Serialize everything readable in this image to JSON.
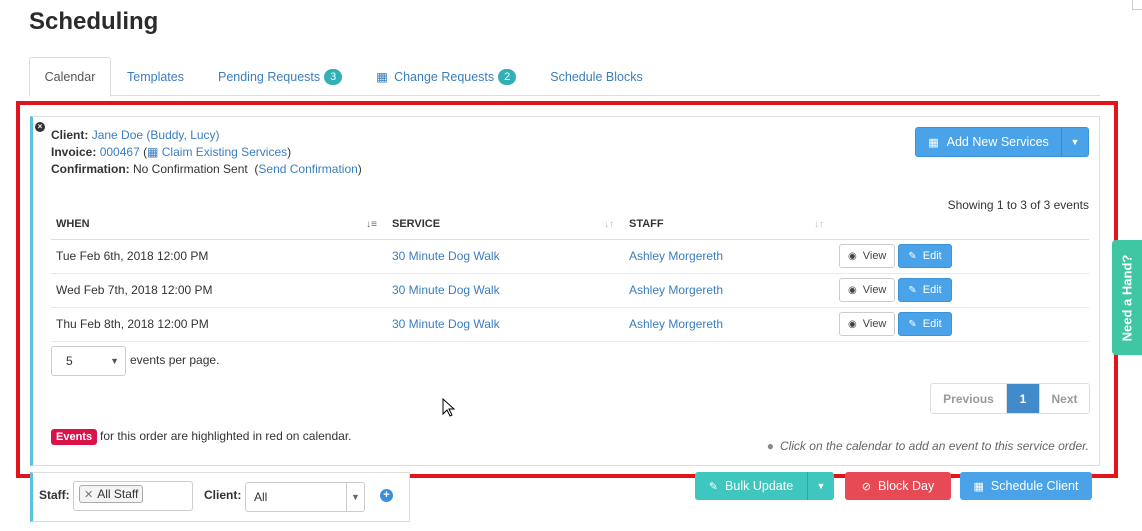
{
  "page": {
    "title": "Scheduling"
  },
  "tabs": [
    {
      "label": "Calendar",
      "active": true
    },
    {
      "label": "Templates"
    },
    {
      "label": "Pending Requests",
      "badge": "3"
    },
    {
      "label": "Change Requests",
      "badge": "2",
      "icon": "calendar-icon"
    },
    {
      "label": "Schedule Blocks"
    }
  ],
  "order": {
    "client_label": "Client:",
    "client_value": "Jane Doe (Buddy, Lucy)",
    "invoice_label": "Invoice:",
    "invoice_number": "000467",
    "invoice_open_paren": "(",
    "claim_link": "Claim Existing Services",
    "invoice_close_paren": ")",
    "confirmation_label": "Confirmation:",
    "confirmation_status": "No Confirmation Sent",
    "send_open_paren": "(",
    "send_link": "Send Confirmation",
    "send_close_paren": ")"
  },
  "add_services": {
    "label": "Add New Services",
    "icon": "calendar-icon"
  },
  "table": {
    "showing": "Showing 1 to 3 of 3 events",
    "headers": [
      "WHEN",
      "SERVICE",
      "STAFF"
    ],
    "rows": [
      {
        "when": "Tue Feb 6th, 2018 12:00 PM",
        "service": "30 Minute Dog Walk",
        "staff": "Ashley Morgereth"
      },
      {
        "when": "Wed Feb 7th, 2018 12:00 PM",
        "service": "30 Minute Dog Walk",
        "staff": "Ashley Morgereth"
      },
      {
        "when": "Thu Feb 8th, 2018 12:00 PM",
        "service": "30 Minute Dog Walk",
        "staff": "Ashley Morgereth"
      }
    ],
    "view_label": "View",
    "edit_label": "Edit"
  },
  "per_page": {
    "value": "5",
    "label": "events per page."
  },
  "pagination": {
    "previous": "Previous",
    "current": "1",
    "next": "Next"
  },
  "legend": {
    "badge": "Events",
    "text": "for this order are highlighted in red on calendar."
  },
  "hint": "Click on the calendar to add an event to this service order.",
  "filters": {
    "staff_label": "Staff:",
    "staff_tag": "All Staff",
    "client_label": "Client:",
    "client_value": "All"
  },
  "bottom_buttons": {
    "bulk_update": "Bulk Update",
    "block_day": "Block Day",
    "schedule_client": "Schedule Client"
  },
  "help_tab": "Need a Hand?",
  "colors": {
    "highlight_frame": "#e2141b",
    "primary": "#4aa3e8",
    "teal": "#3fc6bf",
    "danger": "#e84a55",
    "events_badge": "#d9124a"
  }
}
